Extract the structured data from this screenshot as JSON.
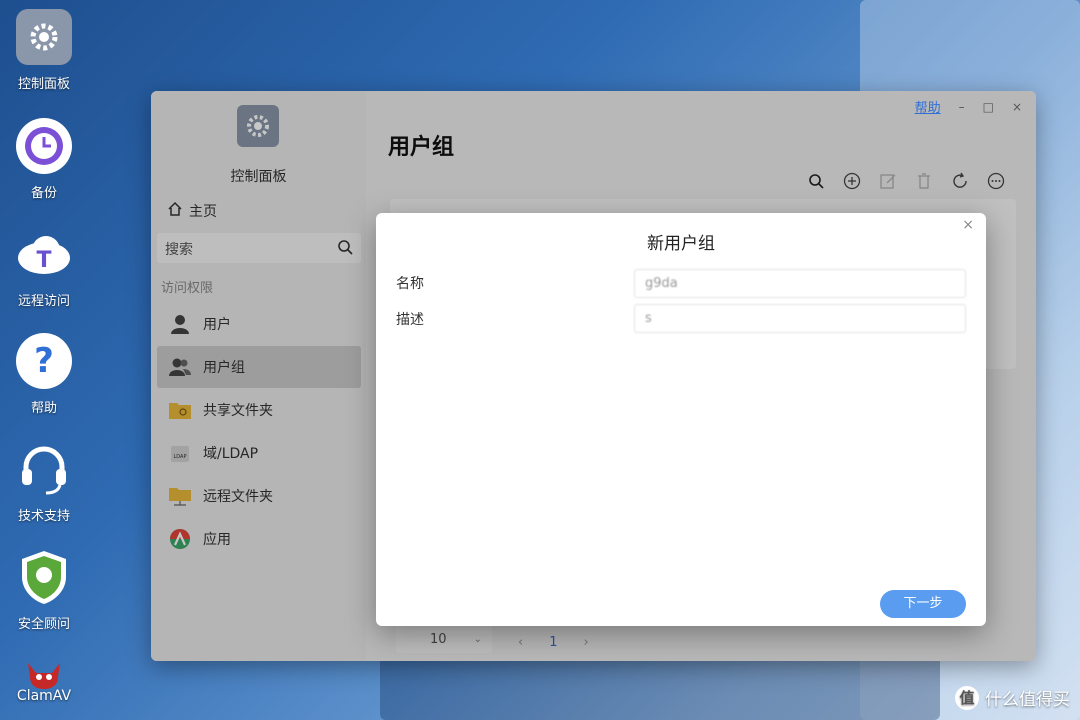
{
  "desktop": {
    "icons": [
      {
        "label": "控制面板",
        "icon": "gear-icon"
      },
      {
        "label": "备份",
        "icon": "clock-icon"
      },
      {
        "label": "远程访问",
        "icon": "cloud-t-icon"
      },
      {
        "label": "帮助",
        "icon": "question-icon"
      },
      {
        "label": "技术支持",
        "icon": "headset-icon"
      },
      {
        "label": "安全顾问",
        "icon": "shield-icon"
      },
      {
        "label": "ClamAV",
        "icon": "clamav-logo"
      }
    ]
  },
  "window": {
    "help_link": "帮助",
    "minimize": "–",
    "maximize": "□",
    "close": "×",
    "app_name": "控制面板",
    "home_label": "主页",
    "search_placeholder": "搜索",
    "section_title": "访问权限",
    "nav": [
      {
        "label": "用户",
        "icon": "user-icon"
      },
      {
        "label": "用户组",
        "icon": "users-icon",
        "active": true
      },
      {
        "label": "共享文件夹",
        "icon": "shared-folder-icon"
      },
      {
        "label": "域/LDAP",
        "icon": "ldap-icon"
      },
      {
        "label": "远程文件夹",
        "icon": "remote-folder-icon"
      },
      {
        "label": "应用",
        "icon": "app-icon"
      }
    ],
    "page_title": "用户组",
    "toolbar": [
      "search-icon",
      "add-icon",
      "edit-icon",
      "delete-icon",
      "refresh-icon",
      "more-icon"
    ],
    "pager": {
      "page_size": "10",
      "current_page": "1"
    }
  },
  "dialog": {
    "title": "新用户组",
    "close": "×",
    "fields": [
      {
        "label": "名称",
        "value": "g9da"
      },
      {
        "label": "描述",
        "value": "s"
      }
    ],
    "next_button": "下一步"
  },
  "watermark": {
    "circle": "值",
    "text": "什么值得买"
  },
  "colors": {
    "accent": "#5a9cf0",
    "link": "#2f6fd6",
    "active_nav": "#c9c9c9"
  }
}
